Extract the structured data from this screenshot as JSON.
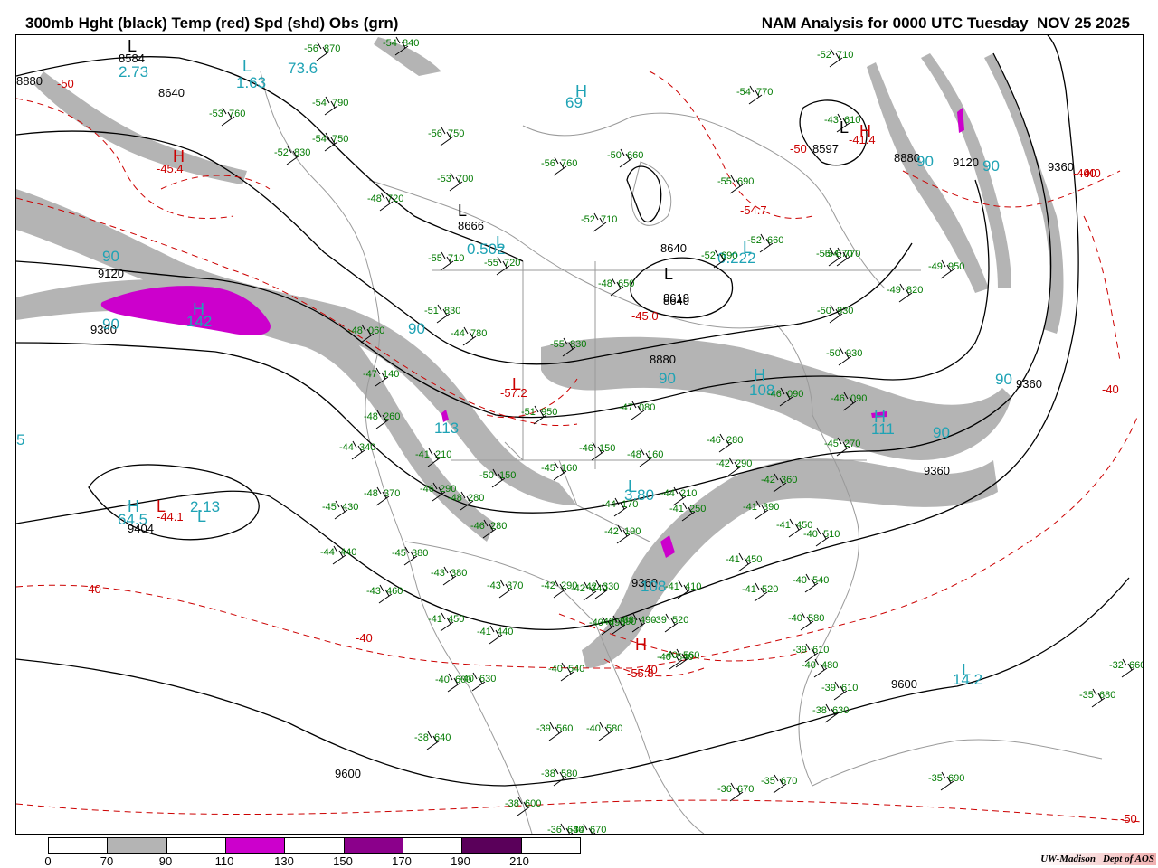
{
  "header": {
    "title": "300mb Hght (black) Temp (red) Spd (shd) Obs (grn)",
    "valid": "NAM Analysis for 0000 UTC Tuesday  NOV 25 2025"
  },
  "legend": {
    "colors": [
      "#ffffff",
      "#b4b4b4",
      "#ffffff",
      "#cc00cc",
      "#ffffff",
      "#8b008b",
      "#ffffff",
      "#5a005a",
      "#ffffff"
    ],
    "ticks": [
      "0",
      "70",
      "90",
      "110",
      "130",
      "150",
      "170",
      "190",
      "210"
    ]
  },
  "credit": {
    "org": "UW-Madison",
    "dept": "Dept of AOS"
  },
  "height_labels": [
    "8584",
    "8880",
    "8640",
    "8597",
    "8880",
    "9120",
    "9360",
    "8666",
    "8640",
    "8619",
    "8640",
    "9120",
    "9360",
    "8880",
    "9360",
    "9360",
    "9404",
    "9360",
    "9600",
    "9600"
  ],
  "temp_labels": [
    "-50",
    "-45.4",
    "-50",
    "-41.4",
    "-40",
    "-54.7",
    "-45.0",
    "-57.2",
    "-44.1",
    "-40",
    "-40",
    "-40",
    "-55.8",
    "-40",
    "-40",
    "-40",
    "-50"
  ],
  "speed_labels": [
    "2.73",
    "1.63",
    "73.6",
    "69",
    "90",
    "90",
    "0.502",
    "0.222",
    "90",
    "90",
    "142",
    "90",
    "113",
    "108",
    "111",
    "90",
    "90",
    "2.13",
    "64.5",
    "3.80",
    "108",
    "14.2",
    "90",
    "5"
  ],
  "obs": [
    {
      "temp": "-56",
      "hgt": "870"
    },
    {
      "temp": "-54",
      "hgt": "840"
    },
    {
      "temp": "-54",
      "hgt": "790"
    },
    {
      "temp": "-53",
      "hgt": "760"
    },
    {
      "temp": "-54",
      "hgt": "750"
    },
    {
      "temp": "-52",
      "hgt": "830"
    },
    {
      "temp": "-56",
      "hgt": "750"
    },
    {
      "temp": "-53",
      "hgt": "700"
    },
    {
      "temp": "-56",
      "hgt": "760"
    },
    {
      "temp": "-50",
      "hgt": "660"
    },
    {
      "temp": "-55",
      "hgt": "690"
    },
    {
      "temp": "-54",
      "hgt": "770"
    },
    {
      "temp": "-52",
      "hgt": "710"
    },
    {
      "temp": "-43",
      "hgt": "610"
    },
    {
      "temp": "-52",
      "hgt": "710"
    },
    {
      "temp": "-48",
      "hgt": "720"
    },
    {
      "temp": "-55",
      "hgt": "710"
    },
    {
      "temp": "-55",
      "hgt": "720"
    },
    {
      "temp": "-52",
      "hgt": "660"
    },
    {
      "temp": "-55",
      "hgt": "670"
    },
    {
      "temp": "-54",
      "hgt": "770"
    },
    {
      "temp": "-49",
      "hgt": "950"
    },
    {
      "temp": "-52",
      "hgt": "690"
    },
    {
      "temp": "-48",
      "hgt": "650"
    },
    {
      "temp": "-49",
      "hgt": "820"
    },
    {
      "temp": "-50",
      "hgt": "830"
    },
    {
      "temp": "-51",
      "hgt": "830"
    },
    {
      "temp": "-48",
      "hgt": "060"
    },
    {
      "temp": "-55",
      "hgt": "830"
    },
    {
      "temp": "-44",
      "hgt": "780"
    },
    {
      "temp": "-50",
      "hgt": "930"
    },
    {
      "temp": "-47",
      "hgt": "140"
    },
    {
      "temp": "-48",
      "hgt": "260"
    },
    {
      "temp": "-51",
      "hgt": "950"
    },
    {
      "temp": "-47",
      "hgt": "080"
    },
    {
      "temp": "-46",
      "hgt": "090"
    },
    {
      "temp": "-46",
      "hgt": "090"
    },
    {
      "temp": "-44",
      "hgt": "340"
    },
    {
      "temp": "-41",
      "hgt": "210"
    },
    {
      "temp": "-46",
      "hgt": "150"
    },
    {
      "temp": "-48",
      "hgt": "160"
    },
    {
      "temp": "-45",
      "hgt": "160"
    },
    {
      "temp": "-46",
      "hgt": "280"
    },
    {
      "temp": "-45",
      "hgt": "270"
    },
    {
      "temp": "-48",
      "hgt": "370"
    },
    {
      "temp": "-46",
      "hgt": "290"
    },
    {
      "temp": "-48",
      "hgt": "280"
    },
    {
      "temp": "-50",
      "hgt": "150"
    },
    {
      "temp": "-44",
      "hgt": "170"
    },
    {
      "temp": "-44",
      "hgt": "210"
    },
    {
      "temp": "-42",
      "hgt": "290"
    },
    {
      "temp": "-42",
      "hgt": "360"
    },
    {
      "temp": "-45",
      "hgt": "430"
    },
    {
      "temp": "-46",
      "hgt": "280"
    },
    {
      "temp": "-42",
      "hgt": "190"
    },
    {
      "temp": "-41",
      "hgt": "250"
    },
    {
      "temp": "-41",
      "hgt": "390"
    },
    {
      "temp": "-41",
      "hgt": "450"
    },
    {
      "temp": "-44",
      "hgt": "440"
    },
    {
      "temp": "-45",
      "hgt": "380"
    },
    {
      "temp": "-43",
      "hgt": "380"
    },
    {
      "temp": "-43",
      "hgt": "370"
    },
    {
      "temp": "-42",
      "hgt": "290"
    },
    {
      "temp": "-42",
      "hgt": "340"
    },
    {
      "temp": "-42",
      "hgt": "330"
    },
    {
      "temp": "-41",
      "hgt": "450"
    },
    {
      "temp": "-40",
      "hgt": "490"
    },
    {
      "temp": "-40",
      "hgt": "510"
    },
    {
      "temp": "-43",
      "hgt": "460"
    },
    {
      "temp": "-40",
      "hgt": "540"
    },
    {
      "temp": "-41",
      "hgt": "520"
    },
    {
      "temp": "-41",
      "hgt": "410"
    },
    {
      "temp": "-41",
      "hgt": "450"
    },
    {
      "temp": "-41",
      "hgt": "440"
    },
    {
      "temp": "-40",
      "hgt": "390"
    },
    {
      "temp": "-38",
      "hgt": "490"
    },
    {
      "temp": "-39",
      "hgt": "520"
    },
    {
      "temp": "-40",
      "hgt": "580"
    },
    {
      "temp": "-40",
      "hgt": "540"
    },
    {
      "temp": "-40",
      "hgt": "560"
    },
    {
      "temp": "-39",
      "hgt": "610"
    },
    {
      "temp": "-40",
      "hgt": "540"
    },
    {
      "temp": "-40",
      "hgt": "600"
    },
    {
      "temp": "-40",
      "hgt": "480"
    },
    {
      "temp": "-39",
      "hgt": "610"
    },
    {
      "temp": "-40",
      "hgt": "630"
    },
    {
      "temp": "-38",
      "hgt": "630"
    },
    {
      "temp": "-39",
      "hgt": "560"
    },
    {
      "temp": "-40",
      "hgt": "580"
    },
    {
      "temp": "-38",
      "hgt": "640"
    },
    {
      "temp": "-38",
      "hgt": "580"
    },
    {
      "temp": "-38",
      "hgt": "600"
    },
    {
      "temp": "-36",
      "hgt": "640"
    },
    {
      "temp": "-34",
      "hgt": "670"
    },
    {
      "temp": "-36",
      "hgt": "670"
    },
    {
      "temp": "-35",
      "hgt": "670"
    },
    {
      "temp": "-35",
      "hgt": "690"
    },
    {
      "temp": "-35",
      "hgt": "680"
    },
    {
      "temp": "-32",
      "hgt": "660"
    },
    {
      "temp": "-31",
      "hgt": "650"
    },
    {
      "temp": "-32",
      "hgt": "6"
    }
  ]
}
